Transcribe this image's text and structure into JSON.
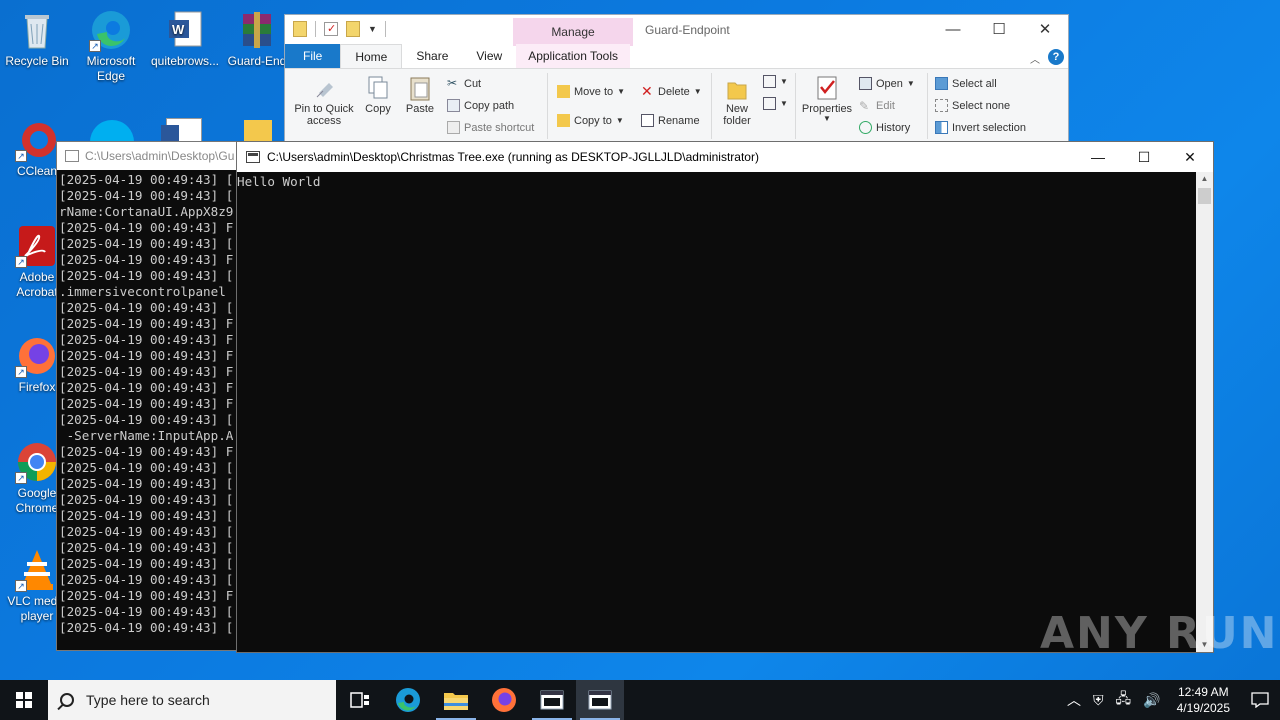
{
  "desktop": {
    "icons": [
      {
        "label": "Recycle Bin"
      },
      {
        "label": "Microsoft Edge"
      },
      {
        "label": "quitebrows..."
      },
      {
        "label": "Guard-End"
      },
      {
        "label": "CClean"
      },
      {
        "label": "Adobe Acrobat"
      },
      {
        "label": "Firefox"
      },
      {
        "label": "Google Chrome"
      },
      {
        "label": "VLC media player"
      }
    ]
  },
  "explorer": {
    "title": "Guard-Endpoint",
    "manage_tab": "Manage",
    "tabs": [
      "File",
      "Home",
      "Share",
      "View",
      "Application Tools"
    ],
    "ribbon": {
      "pin_label": "Pin to Quick access",
      "copy_label": "Copy",
      "paste_label": "Paste",
      "cut_label": "Cut",
      "copy_path_label": "Copy path",
      "paste_shortcut_label": "Paste shortcut",
      "move_to_label": "Move to",
      "copy_to_label": "Copy to",
      "delete_label": "Delete",
      "rename_label": "Rename",
      "new_folder_label": "New folder",
      "properties_label": "Properties",
      "open_label": "Open",
      "edit_label": "Edit",
      "history_label": "History",
      "select_all_label": "Select all",
      "select_none_label": "Select none",
      "invert_selection_label": "Invert selection"
    }
  },
  "console_back": {
    "title": "C:\\Users\\admin\\Desktop\\Gu",
    "lines": [
      "[2025-04-19 00:49:43] [",
      "[2025-04-19 00:49:43] [",
      "rName:CortanaUI.AppX8z9",
      "[2025-04-19 00:49:43] F",
      "[2025-04-19 00:49:43] [",
      "[2025-04-19 00:49:43] F",
      "[2025-04-19 00:49:43] [",
      ".immersivecontrolpanel",
      "[2025-04-19 00:49:43] [",
      "[2025-04-19 00:49:43] F",
      "[2025-04-19 00:49:43] F",
      "[2025-04-19 00:49:43] F",
      "[2025-04-19 00:49:43] F",
      "[2025-04-19 00:49:43] F",
      "[2025-04-19 00:49:43] F",
      "[2025-04-19 00:49:43] [",
      " -ServerName:InputApp.A",
      "[2025-04-19 00:49:43] F",
      "[2025-04-19 00:49:43] [",
      "[2025-04-19 00:49:43] [",
      "[2025-04-19 00:49:43] [",
      "[2025-04-19 00:49:43] [",
      "[2025-04-19 00:49:43] [",
      "[2025-04-19 00:49:43] [",
      "[2025-04-19 00:49:43] [",
      "[2025-04-19 00:49:43] [",
      "[2025-04-19 00:49:43] F",
      "[2025-04-19 00:49:43] [",
      "[2025-04-19 00:49:43] ["
    ]
  },
  "console_front": {
    "title": "C:\\Users\\admin\\Desktop\\Christmas Tree.exe (running as DESKTOP-JGLLJLD\\administrator)",
    "output": "Hello World"
  },
  "watermark": "ANY RUN",
  "taskbar": {
    "search_placeholder": "Type here to search",
    "time": "12:49 AM",
    "date": "4/19/2025"
  }
}
